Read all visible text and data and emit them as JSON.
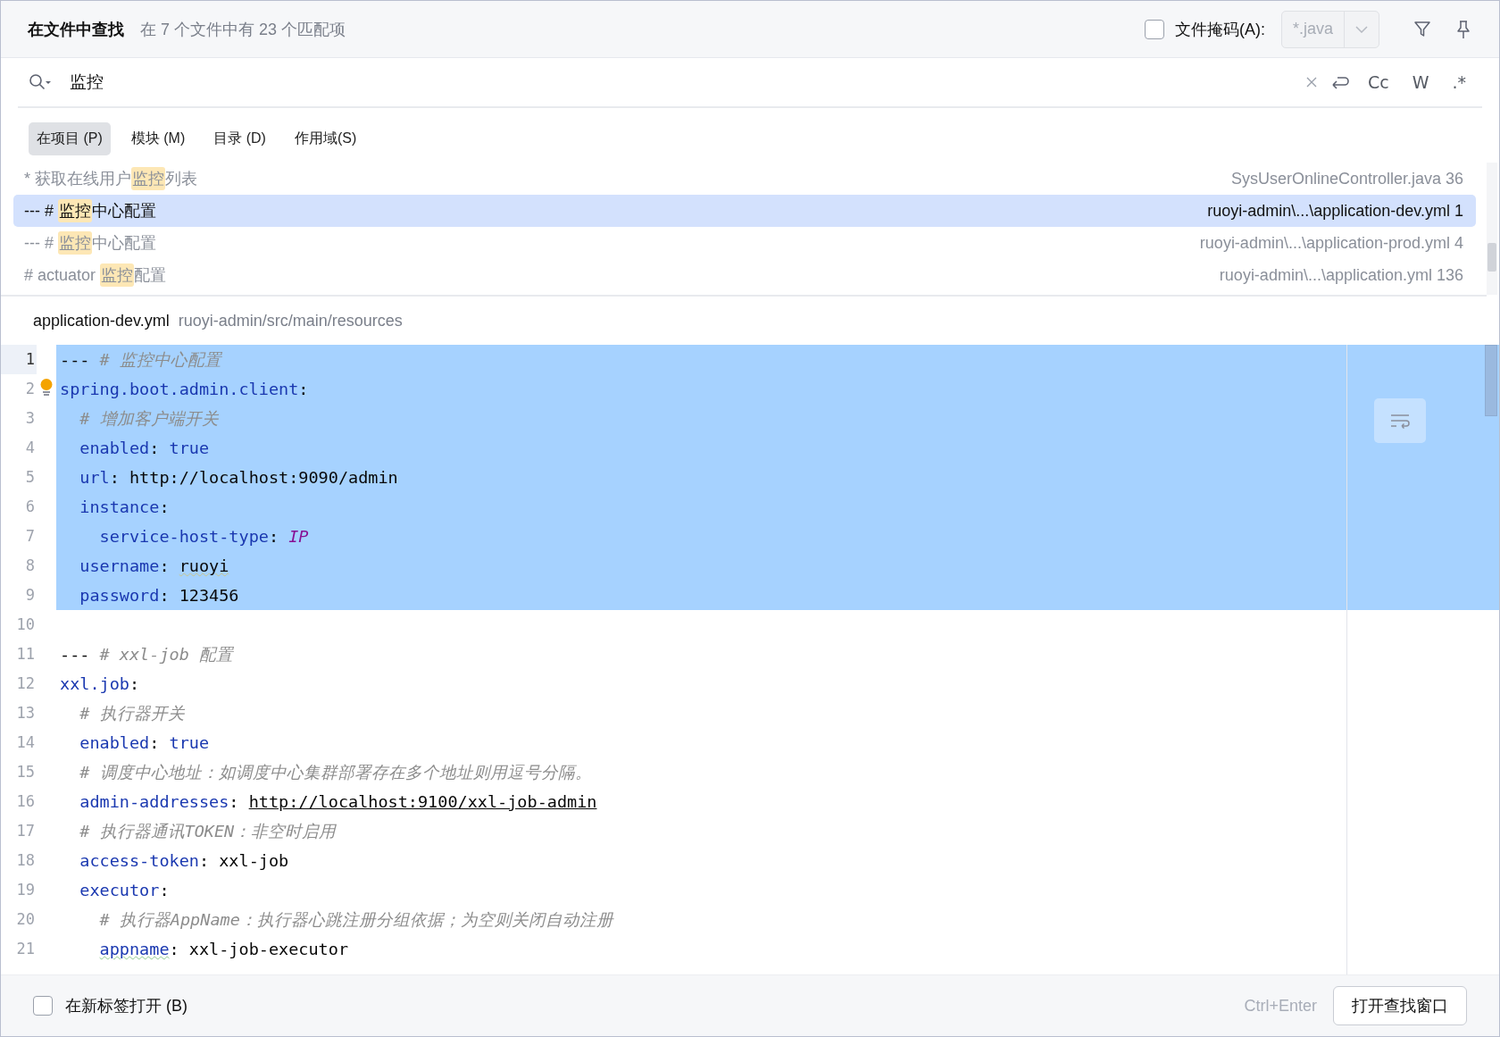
{
  "header": {
    "title": "在文件中查找",
    "summary": "在 7 个文件中有 23 个匹配项",
    "file_mask": {
      "label": "文件掩码(A):",
      "checked": false,
      "value": "*.java",
      "disabled": true
    }
  },
  "search": {
    "value": "监控",
    "toggles": [
      {
        "label": "Cc",
        "selected": false
      },
      {
        "label": "W",
        "selected": false
      },
      {
        "label": ".*",
        "selected": false
      }
    ]
  },
  "scopes": [
    {
      "label": "在项目 (P)",
      "selected": true
    },
    {
      "label": "模块 (M)",
      "selected": false
    },
    {
      "label": "目录 (D)",
      "selected": false
    },
    {
      "label": "作用域(S)",
      "selected": false
    }
  ],
  "results": [
    {
      "before": "* 获取在线用户",
      "match": "监控",
      "after": "列表",
      "location": "SysUserOnlineController.java 36",
      "selected": false
    },
    {
      "before": "--- # ",
      "match": "监控",
      "after": "中心配置",
      "location": "ruoyi-admin\\...\\application-dev.yml 1",
      "selected": true
    },
    {
      "before": "--- # ",
      "match": "监控",
      "after": "中心配置",
      "location": "ruoyi-admin\\...\\application-prod.yml 4",
      "selected": false
    },
    {
      "before": "# actuator ",
      "match": "监控",
      "after": "配置",
      "location": "ruoyi-admin\\...\\application.yml 136",
      "selected": false
    }
  ],
  "preview": {
    "file": "application-dev.yml",
    "path": "ruoyi-admin/src/main/resources",
    "lines": [
      {
        "number": "1",
        "selected": true,
        "current": true,
        "tokens": [
          {
            "kind": "plain",
            "text": "--- "
          },
          {
            "kind": "comment",
            "text": "# 监控中心配置"
          }
        ]
      },
      {
        "number": "2",
        "selected": true,
        "current": false,
        "tokens": [
          {
            "kind": "key",
            "text": "spring.boot.admin.client"
          },
          {
            "kind": "plain",
            "text": ":"
          }
        ]
      },
      {
        "number": "3",
        "selected": true,
        "current": false,
        "tokens": [
          {
            "kind": "comment",
            "text": "  # 增加客户端开关"
          }
        ]
      },
      {
        "number": "4",
        "selected": true,
        "current": false,
        "tokens": [
          {
            "kind": "key",
            "text": "  enabled"
          },
          {
            "kind": "plain",
            "text": ": "
          },
          {
            "kind": "key",
            "text": "true"
          }
        ]
      },
      {
        "number": "5",
        "selected": true,
        "current": false,
        "tokens": [
          {
            "kind": "key",
            "text": "  url"
          },
          {
            "kind": "plain",
            "text": ": http://localhost:9090/admin"
          }
        ]
      },
      {
        "number": "6",
        "selected": true,
        "current": false,
        "tokens": [
          {
            "kind": "key",
            "text": "  instance"
          },
          {
            "kind": "plain",
            "text": ":"
          }
        ]
      },
      {
        "number": "7",
        "selected": true,
        "current": false,
        "tokens": [
          {
            "kind": "key",
            "text": "    service-host-type"
          },
          {
            "kind": "plain",
            "text": ": "
          },
          {
            "kind": "constant",
            "text": "IP"
          }
        ]
      },
      {
        "number": "8",
        "selected": true,
        "current": false,
        "tokens": [
          {
            "kind": "key",
            "text": "  username"
          },
          {
            "kind": "plain",
            "text": ": "
          },
          {
            "kind": "typo",
            "text": "ruoyi"
          }
        ]
      },
      {
        "number": "9",
        "selected": true,
        "current": false,
        "tokens": [
          {
            "kind": "key",
            "text": "  password"
          },
          {
            "kind": "plain",
            "text": ": 123456"
          }
        ]
      },
      {
        "number": "10",
        "selected": false,
        "current": false
      },
      {
        "number": "11",
        "selected": false,
        "current": false,
        "tokens": [
          {
            "kind": "plain",
            "text": "--- "
          },
          {
            "kind": "comment",
            "text": "# xxl-job 配置"
          }
        ]
      },
      {
        "number": "12",
        "selected": false,
        "current": false,
        "tokens": [
          {
            "kind": "key",
            "text": "xxl.job"
          },
          {
            "kind": "plain",
            "text": ":"
          }
        ]
      },
      {
        "number": "13",
        "selected": false,
        "current": false,
        "tokens": [
          {
            "kind": "comment",
            "text": "  # 执行器开关"
          }
        ]
      },
      {
        "number": "14",
        "selected": false,
        "current": false,
        "tokens": [
          {
            "kind": "key",
            "text": "  enabled"
          },
          {
            "kind": "plain",
            "text": ": "
          },
          {
            "kind": "key",
            "text": "true"
          }
        ]
      },
      {
        "number": "15",
        "selected": false,
        "current": false,
        "tokens": [
          {
            "kind": "comment",
            "text": "  # 调度中心地址：如调度中心集群部署存在多个地址则用逗号分隔。"
          }
        ]
      },
      {
        "number": "16",
        "selected": false,
        "current": false,
        "tokens": [
          {
            "kind": "key",
            "text": "  admin-addresses"
          },
          {
            "kind": "plain",
            "text": ": "
          },
          {
            "kind": "link",
            "text": "http://localhost:9100/xxl-job-admin"
          }
        ]
      },
      {
        "number": "17",
        "selected": false,
        "current": false,
        "tokens": [
          {
            "kind": "comment",
            "text": "  # 执行器通讯TOKEN：非空时启用"
          }
        ]
      },
      {
        "number": "18",
        "selected": false,
        "current": false,
        "tokens": [
          {
            "kind": "key",
            "text": "  access-token"
          },
          {
            "kind": "plain",
            "text": ": xxl-job"
          }
        ]
      },
      {
        "number": "19",
        "selected": false,
        "current": false,
        "tokens": [
          {
            "kind": "key",
            "text": "  executor"
          },
          {
            "kind": "plain",
            "text": ":"
          }
        ]
      },
      {
        "number": "20",
        "selected": false,
        "current": false,
        "tokens": [
          {
            "kind": "comment",
            "text": "    # 执行器AppName：执行器心跳注册分组依据；为空则关闭自动注册"
          }
        ]
      },
      {
        "number": "21",
        "selected": false,
        "current": false,
        "tokens": [
          {
            "kind": "typokey",
            "text": "    appname"
          },
          {
            "kind": "plain",
            "text": ": xxl-job-executor"
          }
        ]
      }
    ]
  },
  "footer": {
    "new_tab": {
      "label": "在新标签打开 (B)",
      "checked": false
    },
    "shortcut": "Ctrl+Enter",
    "button": "打开查找窗口"
  }
}
